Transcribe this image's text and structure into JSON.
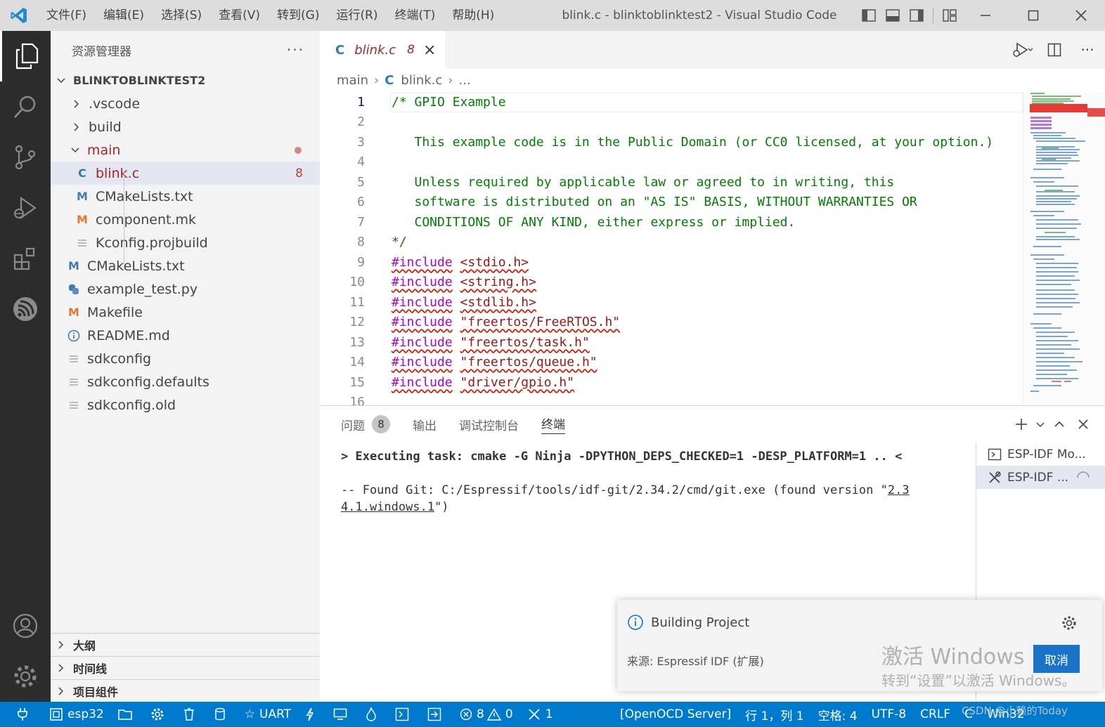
{
  "titlebar": {
    "menu": [
      "文件(F)",
      "编辑(E)",
      "选择(S)",
      "查看(V)",
      "转到(G)",
      "运行(R)",
      "终端(T)",
      "帮助(H)"
    ],
    "window_title": "blink.c - blinktoblinktest2 - Visual Studio Code"
  },
  "sidebar": {
    "title": "资源管理器",
    "root": "BLINKTOBLINKTEST2",
    "items": [
      {
        "label": ".vscode"
      },
      {
        "label": "build"
      },
      {
        "label": "main"
      },
      {
        "label": "blink.c",
        "badge": "8"
      },
      {
        "label": "CMakeLists.txt"
      },
      {
        "label": "component.mk"
      },
      {
        "label": "Kconfig.projbuild"
      },
      {
        "label": "CMakeLists.txt"
      },
      {
        "label": "example_test.py"
      },
      {
        "label": "Makefile"
      },
      {
        "label": "README.md"
      },
      {
        "label": "sdkconfig"
      },
      {
        "label": "sdkconfig.defaults"
      },
      {
        "label": "sdkconfig.old"
      }
    ],
    "sections": [
      "大纲",
      "时间线",
      "项目组件"
    ]
  },
  "editor": {
    "tab": {
      "icon": "C",
      "label": "blink.c",
      "count": "8"
    },
    "breadcrumb": [
      "main",
      "blink.c",
      "..."
    ],
    "lines": [
      {
        "n": "1",
        "text": "/* GPIO Example"
      },
      {
        "n": "2",
        "text": ""
      },
      {
        "n": "3",
        "text": "   This example code is in the Public Domain (or CC0 licensed, at your option.)"
      },
      {
        "n": "4",
        "text": ""
      },
      {
        "n": "5",
        "text": "   Unless required by applicable law or agreed to in writing, this"
      },
      {
        "n": "6",
        "text": "   software is distributed on an \"AS IS\" BASIS, WITHOUT WARRANTIES OR"
      },
      {
        "n": "7",
        "text": "   CONDITIONS OF ANY KIND, either express or implied."
      },
      {
        "n": "8",
        "text": "*/"
      },
      {
        "n": "9",
        "inc": "#include",
        "hdr": "<stdio.h>"
      },
      {
        "n": "10",
        "inc": "#include",
        "hdr": "<string.h>"
      },
      {
        "n": "11",
        "inc": "#include",
        "hdr": "<stdlib.h>"
      },
      {
        "n": "12",
        "inc": "#include",
        "hdr": "\"freertos/FreeRTOS.h\""
      },
      {
        "n": "13",
        "inc": "#include",
        "hdr": "\"freertos/task.h\""
      },
      {
        "n": "14",
        "inc": "#include",
        "hdr": "\"freertos/queue.h\""
      },
      {
        "n": "15",
        "inc": "#include",
        "hdr": "\"driver/gpio.h\""
      },
      {
        "n": "16",
        "text": ""
      }
    ]
  },
  "panel": {
    "tabs": [
      {
        "label": "问题",
        "badge": "8"
      },
      {
        "label": "输出"
      },
      {
        "label": "调试控制台"
      },
      {
        "label": "终端"
      }
    ],
    "terminal": {
      "line1": "> Executing task: cmake -G Ninja -DPYTHON_DEPS_CHECKED=1 -DESP_PLATFORM=1 .. <",
      "line2a": "-- Found Git: C:/Espressif/tools/idf-git/2.34.2/cmd/git.exe (found version \"",
      "line2b": "2.3",
      "line3a": "4.1.windows.1",
      "line3b": "\")"
    },
    "terminal_list": [
      "ESP-IDF Mo...",
      "ESP-IDF ..."
    ]
  },
  "notification": {
    "title": "Building Project",
    "source": "来源: Espressif IDF (扩展)",
    "cancel": "取消"
  },
  "watermark": {
    "line1": "激活 Windows",
    "line2": "转到“设置”以激活 Windows。",
    "csdn": "CSDN @小赖的Today"
  },
  "statusbar": {
    "chip": "esp32",
    "uart": "UART",
    "errors": "8",
    "warnings": "0",
    "tools": "1",
    "openocd": "[OpenOCD Server]",
    "position": "行 1，列 1",
    "spaces": "空格: 4",
    "encoding": "UTF-8",
    "eol": "CRLF",
    "lang": "C",
    "platform": "Win32"
  },
  "colors": {
    "statusbar": "#007acc",
    "activitybar": "#2c2c2c",
    "error": "#c43a3a"
  }
}
